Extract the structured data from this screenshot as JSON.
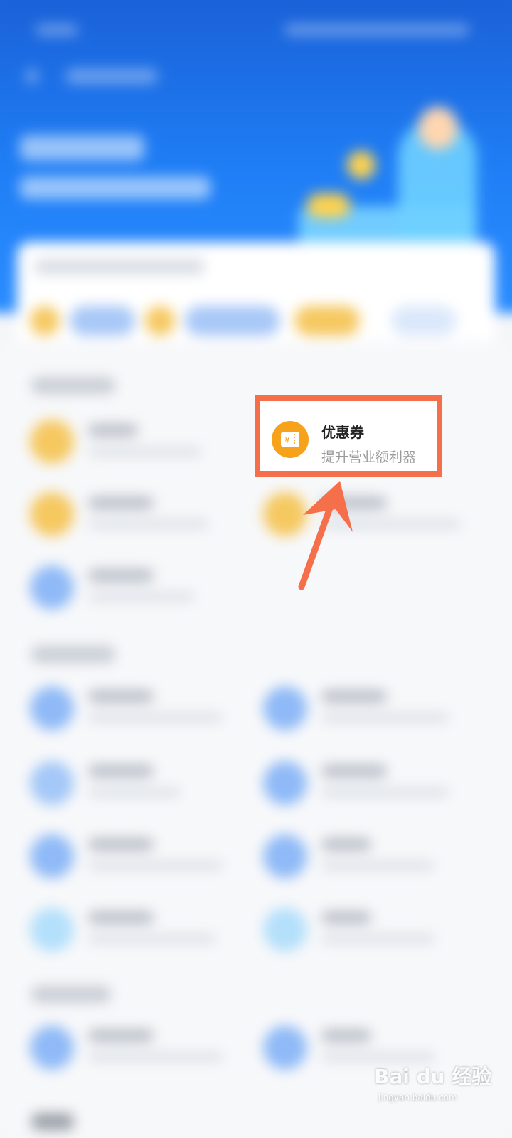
{
  "highlight": {
    "title": "优惠券",
    "subtitle": "提升营业额利器",
    "icon": "coupon-icon",
    "icon_symbol": "¥"
  },
  "annotation": {
    "arrow_color": "#f5704a",
    "box_color": "#f5704a"
  },
  "watermark": {
    "brand": "Bai du 经验",
    "url": "jingyan.baidu.com"
  },
  "colors": {
    "header_blue": "#1f7ef5",
    "icon_orange": "#f7a21b",
    "icon_blue": "#8fbaf7"
  }
}
